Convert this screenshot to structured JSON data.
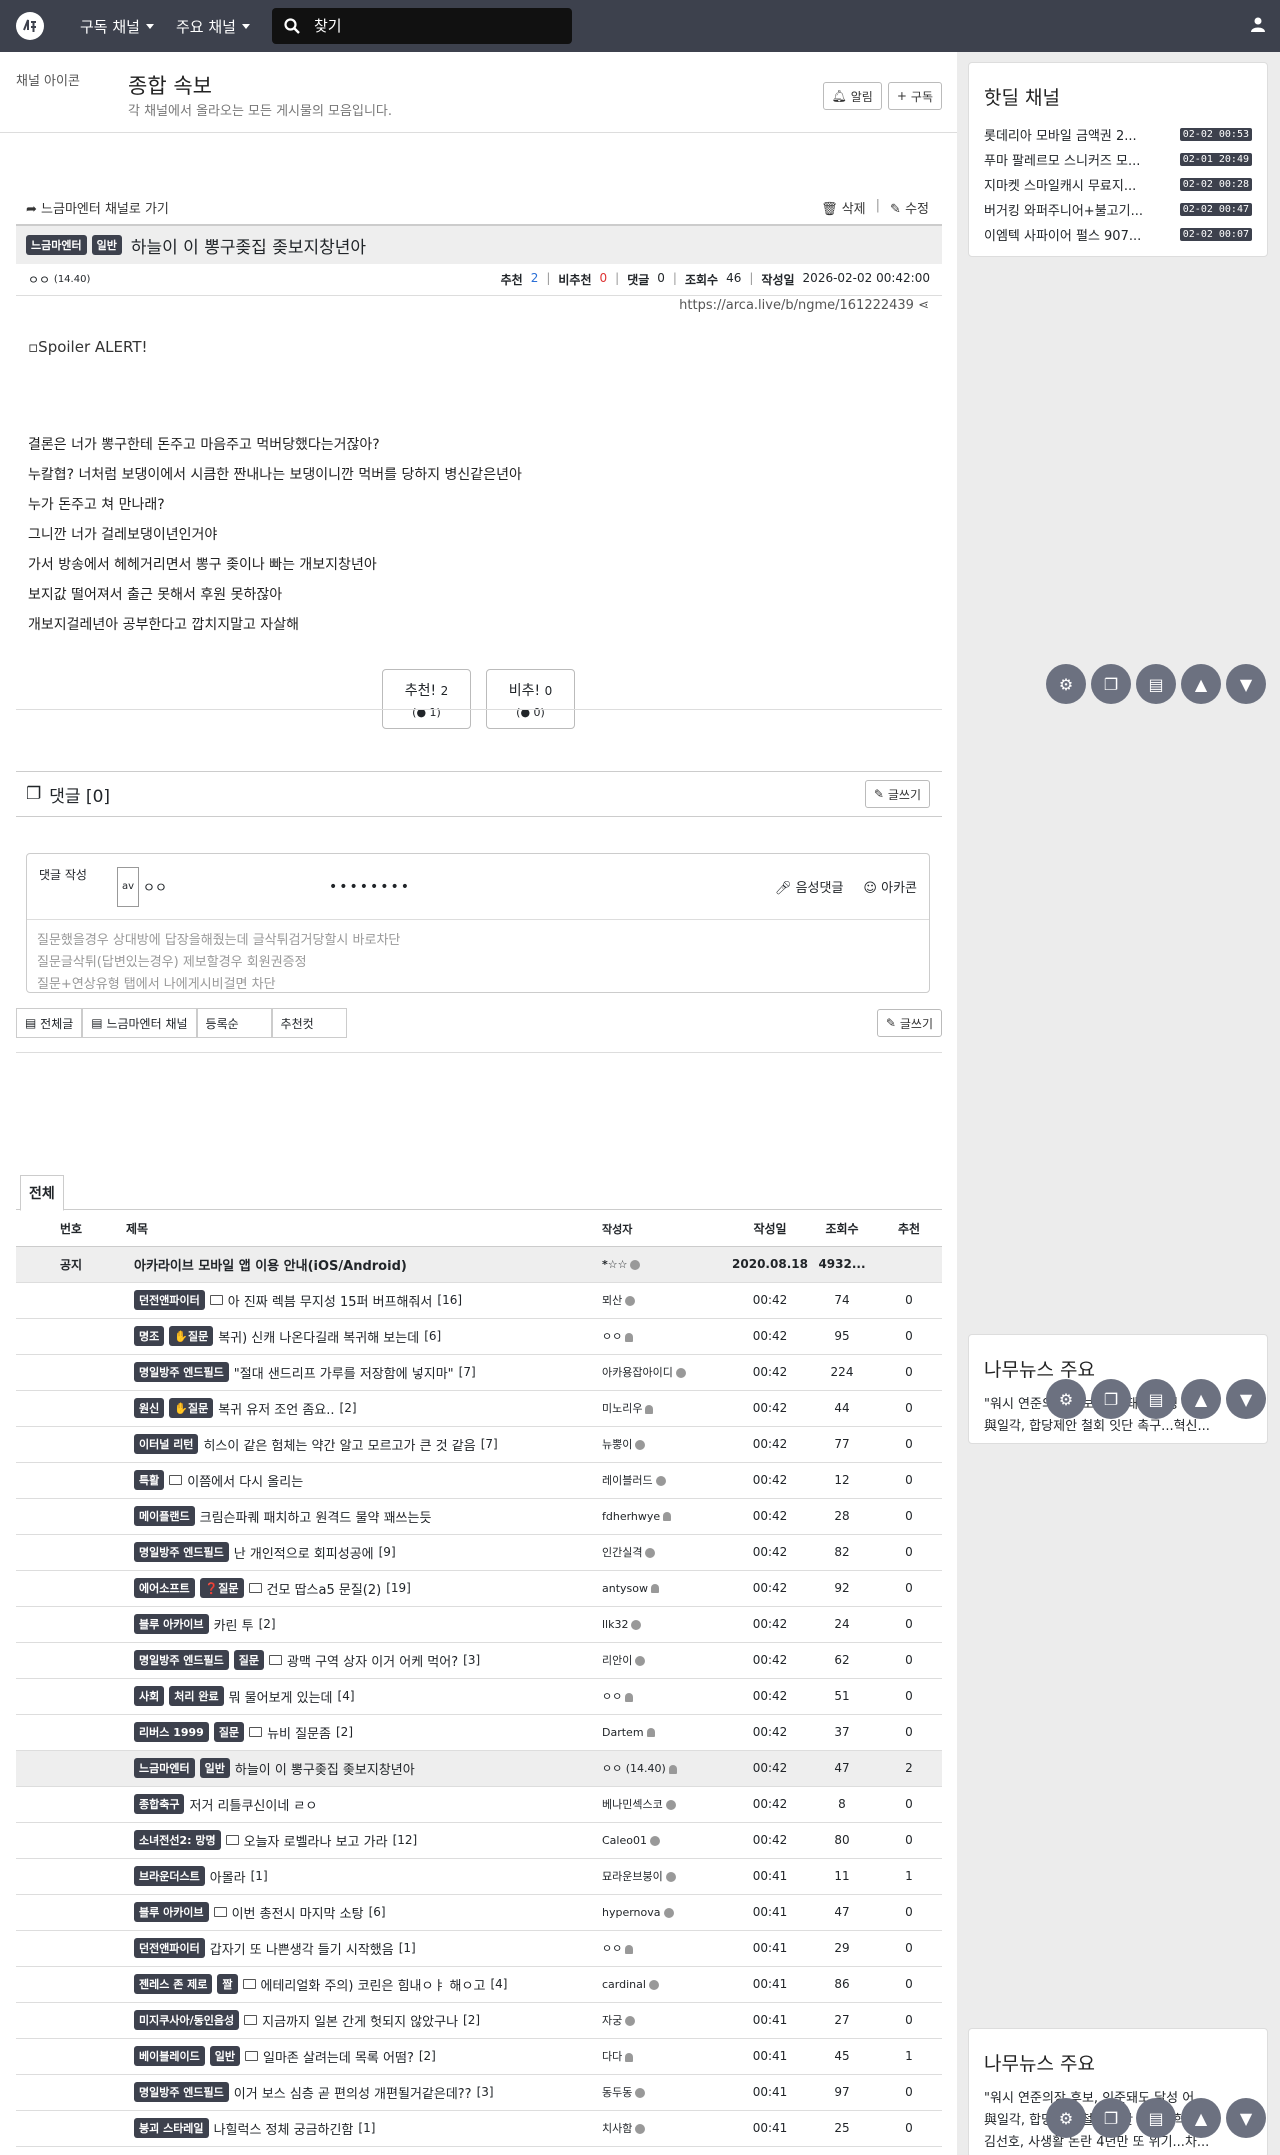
{
  "nav": {
    "dd1": "구독 채널",
    "dd2": "주요 채널",
    "search_placeholder": "찾기"
  },
  "board": {
    "icon_alt": "채널 아이콘",
    "title": "종합 속보",
    "desc": "각 채널에서 올라오는 모든 게시물의 모음입니다.",
    "alarm": "알림",
    "subscribe": "구독"
  },
  "article": {
    "back": "느금마엔터 채널로 가기",
    "delete": "삭제",
    "edit": "수정",
    "tag1": "느금마엔터",
    "tag2": "일반",
    "title": "하늘이 이 뽕구좆집 좆보지창년아",
    "author": "ㅇㅇ",
    "author_ip": "(14.40)",
    "rec_label": "추천",
    "rec": "2",
    "unrec_label": "비추천",
    "unrec": "0",
    "cmt_label": "댓글",
    "cmt": "0",
    "view_label": "조회수",
    "views": "46",
    "date_label": "작성일",
    "date": "2026-02-02 00:42:00",
    "url": "https://arca.live/b/ngme/161222439",
    "spoiler": "Spoiler ALERT!",
    "lines": [
      "결론은 너가 뽕구한테 돈주고 마음주고 먹버당했다는거잖아?",
      "누칼협? 너처럼 보댕이에서 시큼한 짠내나는 보댕이니깐 먹버를 당하지 병신같은년아",
      "누가 돈주고 쳐 만나래?",
      "그니깐 너가 걸레보댕이년인거야",
      "가서 방송에서 헤헤거리면서 뽕구 좆이나 빠는 개보지창년아",
      "보지값 떨어져서 출근 못해서 후원 못하잖아",
      "개보지걸레년아 공부한다고 깝치지말고 자살해"
    ],
    "vote_up": "추천!",
    "vote_up_count": "2",
    "vote_up_sub": "1",
    "vote_down": "비추!",
    "vote_down_count": "0",
    "vote_down_sub": "0"
  },
  "comments": {
    "header": "댓글 [0]",
    "write": "글쓰기",
    "box_label": "댓글 작성",
    "avatar_alt": "av",
    "nick": "ㅇㅇ",
    "password": "••••••••",
    "voice": "음성댓글",
    "arcacon": "아카콘",
    "placeholder_lines": [
      "질문했을경우 상대방에 답장을해줬는데 글삭튀검거당할시 바로차단",
      "질문글삭튀(답변있는경우) 제보할경우 회원권증정",
      "질문+연상유형 탭에서 나에게시비걸면 차단"
    ]
  },
  "listbar": {
    "all": "전체글",
    "channel": "느금마엔터 채널",
    "order": "등록순",
    "best": "추천컷",
    "write": "글쓰기"
  },
  "list": {
    "tab": "전체",
    "headers": {
      "no": "번호",
      "title": "제목",
      "author": "작성자",
      "date": "작성일",
      "views": "조회수",
      "rec": "추천"
    },
    "notice": {
      "no": "공지",
      "title": "아카라이브 모바일 앱 이용 안내(iOS/Android)",
      "author": "*☆☆",
      "date": "2020.08.18",
      "views": "4932...",
      "rec": ""
    },
    "rows": [
      {
        "tags": [
          "던전앤파이터"
        ],
        "doc": true,
        "title": "아 진짜 렉븜 무지성 15퍼 버프해줘서",
        "cnt": "[16]",
        "author": "뫼산",
        "v": true,
        "date": "00:42",
        "views": "74",
        "rec": "0"
      },
      {
        "tags": [
          "명조",
          "✋질문"
        ],
        "doc": false,
        "title": "복귀) 신캐 나온다길래 복귀해 보는데",
        "cnt": "[6]",
        "author": "ㅇㅇ",
        "v": false,
        "date": "00:42",
        "views": "95",
        "rec": "0"
      },
      {
        "tags": [
          "명일방주 엔드필드"
        ],
        "doc": false,
        "title": "\"절대 샌드리프 가루를 저장함에 넣지마\"",
        "cnt": "[7]",
        "author": "아카용잡아이디",
        "v": true,
        "date": "00:42",
        "views": "224",
        "rec": "0"
      },
      {
        "tags": [
          "원신",
          "✋질문"
        ],
        "doc": false,
        "title": "복귀 유저 조언 좀요..",
        "cnt": "[2]",
        "author": "미노리우",
        "v": false,
        "date": "00:42",
        "views": "44",
        "rec": "0"
      },
      {
        "tags": [
          "이터널 리턴"
        ],
        "doc": false,
        "title": "히스이 같은 험체는 약간 알고 모르고가 큰 것 같음",
        "cnt": "[7]",
        "author": "뉴뿡이",
        "v": true,
        "date": "00:42",
        "views": "77",
        "rec": "0"
      },
      {
        "tags": [
          "특활"
        ],
        "doc": true,
        "title": "이쯤에서 다시 올리는",
        "cnt": "",
        "author": "레이블러드",
        "v": true,
        "date": "00:42",
        "views": "12",
        "rec": "0"
      },
      {
        "tags": [
          "메이플랜드"
        ],
        "doc": false,
        "title": "크림슨파퀘 패치하고 원격드 물약 꽤쓰는듯",
        "cnt": "",
        "author": "fdherhwye",
        "v": false,
        "date": "00:42",
        "views": "28",
        "rec": "0"
      },
      {
        "tags": [
          "명일방주 엔드필드"
        ],
        "doc": false,
        "title": "난 개인적으로 회피성공에",
        "cnt": "[9]",
        "author": "인간실격",
        "v": true,
        "date": "00:42",
        "views": "82",
        "rec": "0"
      },
      {
        "tags": [
          "에어소프트",
          "❓질문"
        ],
        "doc": true,
        "title": "건모 땁스a5 문질(2)",
        "cnt": "[19]",
        "author": "antysow",
        "v": false,
        "date": "00:42",
        "views": "92",
        "rec": "0"
      },
      {
        "tags": [
          "블루 아카이브"
        ],
        "doc": false,
        "title": "카린 투",
        "cnt": "[2]",
        "author": "llk32",
        "v": true,
        "date": "00:42",
        "views": "24",
        "rec": "0"
      },
      {
        "tags": [
          "명일방주 엔드필드",
          "질문"
        ],
        "doc": true,
        "title": "광맥 구역 상자 이거 어케 먹어?",
        "cnt": "[3]",
        "author": "리안이",
        "v": true,
        "date": "00:42",
        "views": "62",
        "rec": "0"
      },
      {
        "tags": [
          "사회",
          "처리 완료"
        ],
        "doc": false,
        "title": "뭐 물어보게 있는데",
        "cnt": "[4]",
        "author": "ㅇㅇ",
        "v": false,
        "date": "00:42",
        "views": "51",
        "rec": "0"
      },
      {
        "tags": [
          "리버스 1999",
          "질문"
        ],
        "doc": true,
        "title": "뉴비 질문좀",
        "cnt": "[2]",
        "author": "Dartem",
        "v": false,
        "date": "00:42",
        "views": "37",
        "rec": "0"
      },
      {
        "tags": [
          "느금마엔터",
          "일반"
        ],
        "doc": false,
        "title": "하늘이 이 뽕구좆집 좆보지창년아",
        "cnt": "",
        "author": "ㅇㅇ (14.40)",
        "v": false,
        "date": "00:42",
        "views": "47",
        "rec": "2",
        "current": true
      },
      {
        "tags": [
          "종합축구"
        ],
        "doc": false,
        "title": "저거 리틀쿠신이네 ㄹㅇ",
        "cnt": "",
        "author": "베나민섹스코",
        "v": true,
        "date": "00:42",
        "views": "8",
        "rec": "0"
      },
      {
        "tags": [
          "소녀전선2: 망명"
        ],
        "doc": true,
        "title": "오늘자 로벨라나 보고 가라",
        "cnt": "[12]",
        "author": "Caleo01",
        "v": true,
        "date": "00:42",
        "views": "80",
        "rec": "0"
      },
      {
        "tags": [
          "브라운더스트"
        ],
        "doc": false,
        "title": "아몰라",
        "cnt": "[1]",
        "author": "묘라운브붕이",
        "v": true,
        "date": "00:41",
        "views": "11",
        "rec": "1"
      },
      {
        "tags": [
          "블루 아카이브"
        ],
        "doc": true,
        "title": "이번 총전시 마지막 소탕",
        "cnt": "[6]",
        "author": "hypernova",
        "v": true,
        "date": "00:41",
        "views": "47",
        "rec": "0"
      },
      {
        "tags": [
          "던전앤파이터"
        ],
        "doc": false,
        "title": "갑자기 또 나쁜생각 들기 시작했음",
        "cnt": "[1]",
        "author": "ㅇㅇ",
        "v": false,
        "date": "00:41",
        "views": "29",
        "rec": "0"
      },
      {
        "tags": [
          "젠레스 존 제로",
          "짤"
        ],
        "doc": true,
        "title": "에테리얼화 주의) 코린은 힘내ㅇㅑ 해ㅇ고",
        "cnt": "[4]",
        "author": "cardinal",
        "v": true,
        "date": "00:41",
        "views": "86",
        "rec": "0"
      },
      {
        "tags": [
          "미지쿠사아/동인음성"
        ],
        "doc": true,
        "title": "지금까지 일본 간게 헛되지 않았구나",
        "cnt": "[2]",
        "author": "자궁",
        "v": true,
        "date": "00:41",
        "views": "27",
        "rec": "0"
      },
      {
        "tags": [
          "베이블레이드",
          "일반"
        ],
        "doc": true,
        "title": "일마존 살려는데 목록 어떰?",
        "cnt": "[2]",
        "author": "다다",
        "v": false,
        "date": "00:41",
        "views": "45",
        "rec": "1"
      },
      {
        "tags": [
          "명일방주 엔드필드"
        ],
        "doc": false,
        "title": "이거 보스 심층 곧 편의성 개편될거같은데??",
        "cnt": "[3]",
        "author": "동두동",
        "v": true,
        "date": "00:41",
        "views": "97",
        "rec": "0"
      },
      {
        "tags": [
          "붕괴 스타레일"
        ],
        "doc": false,
        "title": "나힐럭스 정체 궁금하긴함",
        "cnt": "[1]",
        "author": "치사함",
        "v": true,
        "date": "00:41",
        "views": "25",
        "rec": "0"
      }
    ]
  },
  "sidebar": {
    "hot_title": "핫딜 채널",
    "hot": [
      {
        "t": "롯데리아 모바일 금액권 2...",
        "d": "02-02 00:53"
      },
      {
        "t": "푸마 팔레르모 스니커즈 모...",
        "d": "02-01 20:49"
      },
      {
        "t": "지마켓 스마일캐시 무료지...",
        "d": "02-02 00:28"
      },
      {
        "t": "버거킹 와퍼주니어+불고기...",
        "d": "02-02 00:47"
      },
      {
        "t": "이엠텍 사파이어 펄스 907...",
        "d": "02-02 00:07"
      }
    ],
    "news_title": "나무뉴스 주요",
    "news1": [
      "\"워시 연준의장 후보, 인준돼도 달성 어...",
      "與일각, 합당제안 철회 잇단 촉구...혁신..."
    ],
    "news2": [
      "\"워시 연준의장 후보, 인준돼도 달성 어...",
      "與일각, 합당제안 철회 잇단 촉구...혁신...",
      "김선호, 사생활 논란 4년만 또 위기...차..."
    ]
  }
}
